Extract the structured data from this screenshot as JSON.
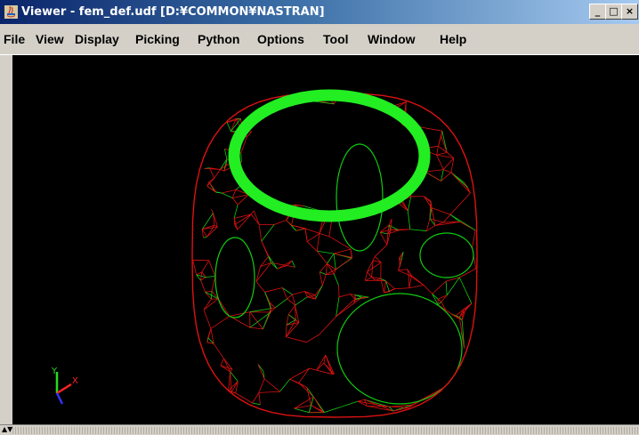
{
  "window": {
    "title": "Viewer - fem_def.udf [D:¥COMMON¥NASTRAN]",
    "buttons": {
      "minimize": "_",
      "maximize": "□",
      "close": "×"
    }
  },
  "menu": {
    "items": [
      "File",
      "View",
      "Display",
      "Picking",
      "Python",
      "Options",
      "Tool",
      "Window",
      "Help"
    ]
  },
  "viewport": {
    "background": "#000000",
    "mesh_color": "#dd1111",
    "edge_color": "#11cc11",
    "ring_color": "#22ee22",
    "axes": {
      "y": "Y",
      "x": "X",
      "y_color": "#22dd22",
      "x_color": "#ff2222",
      "z_color": "#3333ff"
    }
  },
  "status": {
    "arrows": "▲▼"
  }
}
